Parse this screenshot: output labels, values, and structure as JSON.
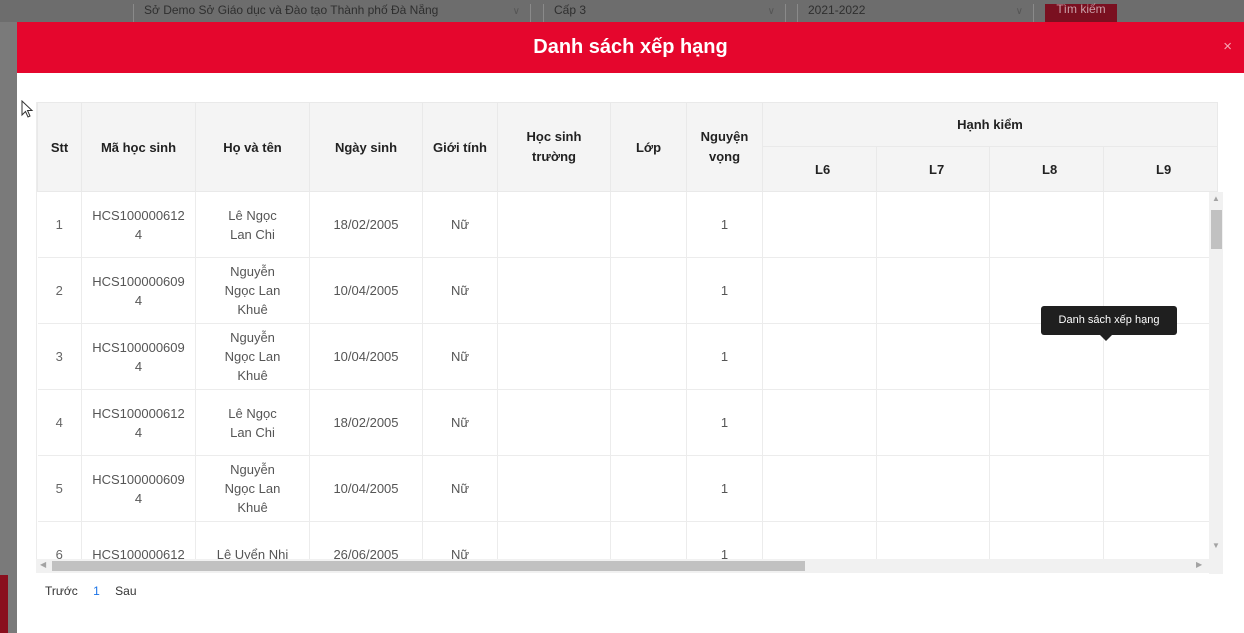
{
  "background": {
    "select_department": "Sở Demo Sở Giáo dục và Đào tạo Thành phố Đà Nẵng",
    "select_level": "Cấp 3",
    "select_year": "2021-2022",
    "search_button": "Tìm kiếm"
  },
  "modal": {
    "title": "Danh sách xếp hạng",
    "close_symbol": "×"
  },
  "table": {
    "headers": {
      "stt": "Stt",
      "student_code": "Mã học sinh",
      "full_name": "Họ và tên",
      "birth_date": "Ngày sinh",
      "gender": "Giới tính",
      "school": "Học sinh trường",
      "class": "Lớp",
      "wish": "Nguyện vọng",
      "conduct": "Hạnh kiểm",
      "conduct_l6": "L6",
      "conduct_l7": "L7",
      "conduct_l8": "L8",
      "conduct_l9": "L9"
    },
    "rows": [
      {
        "stt": "1",
        "code": "HCS100000612 4",
        "name": "Lê Ngọc Lan Chi",
        "dob": "18/02/2005",
        "gender": "Nữ",
        "wish": "1"
      },
      {
        "stt": "2",
        "code": "HCS100000609 4",
        "name": "Nguyễn Ngọc Lan Khuê",
        "dob": "10/04/2005",
        "gender": "Nữ",
        "wish": "1"
      },
      {
        "stt": "3",
        "code": "HCS100000609 4",
        "name": "Nguyễn Ngọc Lan Khuê",
        "dob": "10/04/2005",
        "gender": "Nữ",
        "wish": "1"
      },
      {
        "stt": "4",
        "code": "HCS100000612 4",
        "name": "Lê Ngọc Lan Chi",
        "dob": "18/02/2005",
        "gender": "Nữ",
        "wish": "1"
      },
      {
        "stt": "5",
        "code": "HCS100000609 4",
        "name": "Nguyễn Ngọc Lan Khuê",
        "dob": "10/04/2005",
        "gender": "Nữ",
        "wish": "1"
      },
      {
        "stt": "6",
        "code": "HCS100000612",
        "name": "Lê Uyển Nhi",
        "dob": "26/06/2005",
        "gender": "Nữ",
        "wish": "1"
      }
    ]
  },
  "tooltip": {
    "text": "Danh sách xếp hạng"
  },
  "pagination": {
    "prev": "Trước",
    "current_page": "1",
    "next": "Sau"
  },
  "colors": {
    "brand_red": "#e5062d",
    "link_blue": "#1a73e8"
  }
}
